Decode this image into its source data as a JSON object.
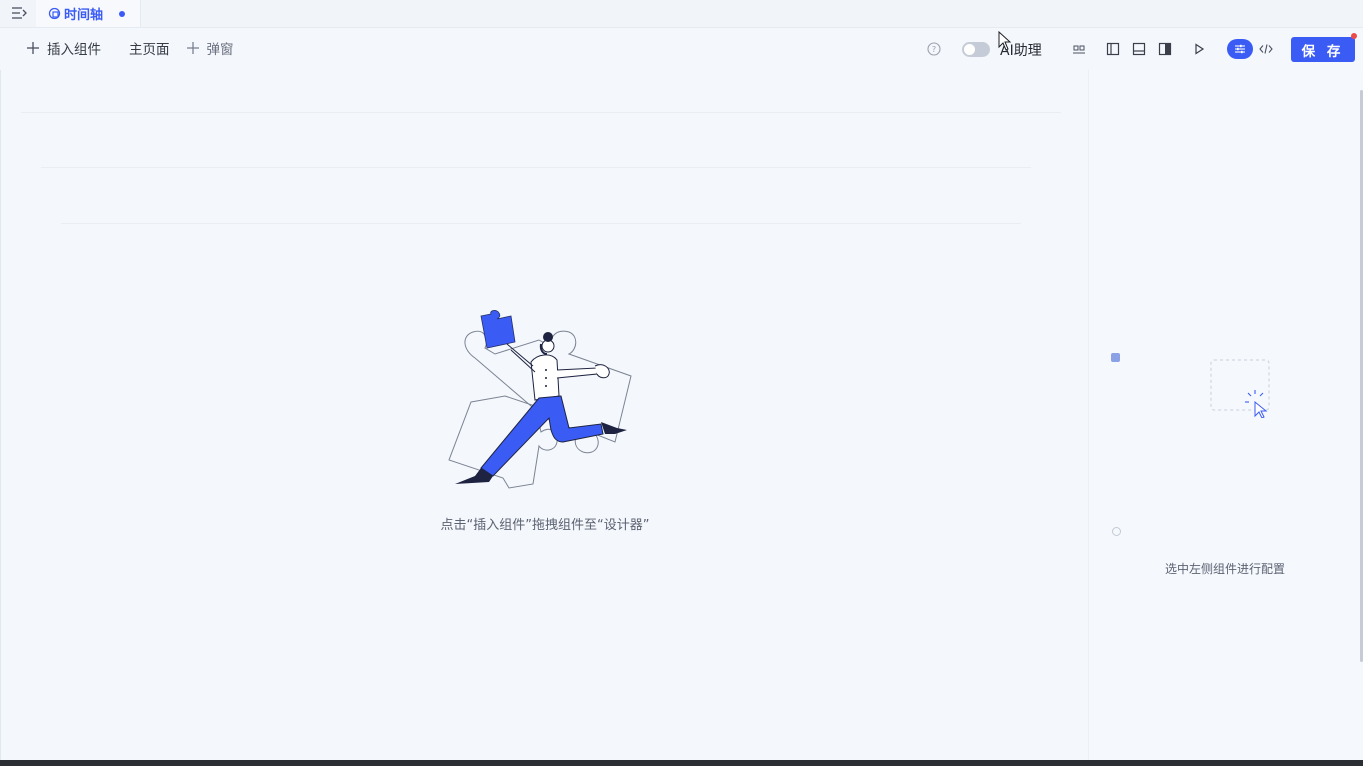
{
  "tabbar": {
    "tab_label": "时间轴"
  },
  "toolbar": {
    "insert_component": "插入组件",
    "main_page": "主页面",
    "popup": "弹窗",
    "ai_assistant": "AI助理",
    "save": "保 存"
  },
  "canvas": {
    "hint": "点击“插入组件”拖拽组件至“设计器”"
  },
  "panel": {
    "hint": "选中左侧组件进行配置"
  },
  "colors": {
    "accent": "#3b5bf5",
    "badge": "#ef4a4a"
  }
}
